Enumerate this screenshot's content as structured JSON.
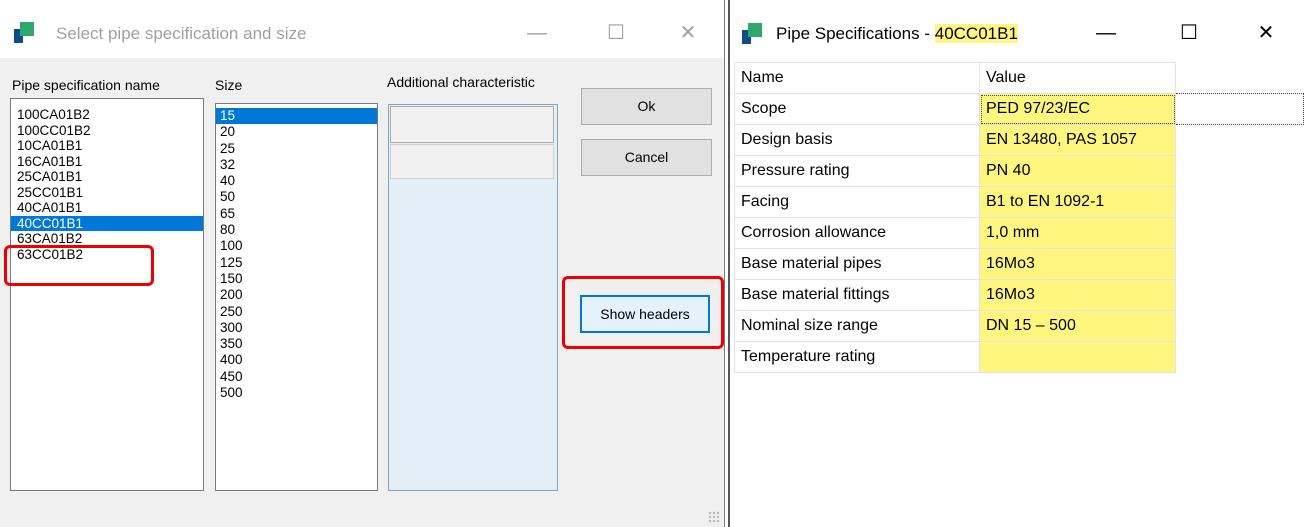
{
  "select_dialog": {
    "title": "Select pipe specification and size",
    "minimize": "—",
    "maximize": "☐",
    "close": "✕",
    "headers": {
      "spec_name": "Pipe specification name",
      "size": "Size",
      "additional": "Additional characteristic"
    },
    "spec_list": [
      "100CA01B2",
      "100CC01B2",
      "10CA01B1",
      "16CA01B1",
      "25CA01B1",
      "25CC01B1",
      "40CA01B1",
      "40CC01B1",
      "63CA01B2",
      "63CC01B2"
    ],
    "selected_spec": "40CC01B1",
    "size_list": [
      "15",
      "20",
      "25",
      "32",
      "40",
      "50",
      "65",
      "80",
      "100",
      "125",
      "150",
      "200",
      "250",
      "300",
      "350",
      "400",
      "450",
      "500"
    ],
    "selected_size": "15",
    "ok_label": "Ok",
    "cancel_label": "Cancel",
    "show_headers_label": "Show headers"
  },
  "spec_window": {
    "title_prefix": "Pipe Specifications - ",
    "title_spec": "40CC01B1",
    "minimize": "—",
    "maximize": "☐",
    "close": "✕",
    "columns": [
      "Name",
      "Value"
    ],
    "rows": [
      {
        "name": "Scope",
        "value": "PED 97/23/EC"
      },
      {
        "name": "Design basis",
        "value": "EN 13480, PAS 1057"
      },
      {
        "name": "Pressure rating",
        "value": "PN 40"
      },
      {
        "name": "Facing",
        "value": "B1 to EN 1092-1"
      },
      {
        "name": "Corrosion allowance",
        "value": "1,0 mm"
      },
      {
        "name": "Base material pipes",
        "value": "16Mo3"
      },
      {
        "name": "Base material fittings",
        "value": "16Mo3"
      },
      {
        "name": "Nominal size range",
        "value": "DN 15 – 500"
      },
      {
        "name": "Temperature rating",
        "value": ""
      }
    ]
  },
  "colors": {
    "selection": "#0078d7",
    "highlight": "#fff680",
    "annotation_red": "#e00000"
  }
}
